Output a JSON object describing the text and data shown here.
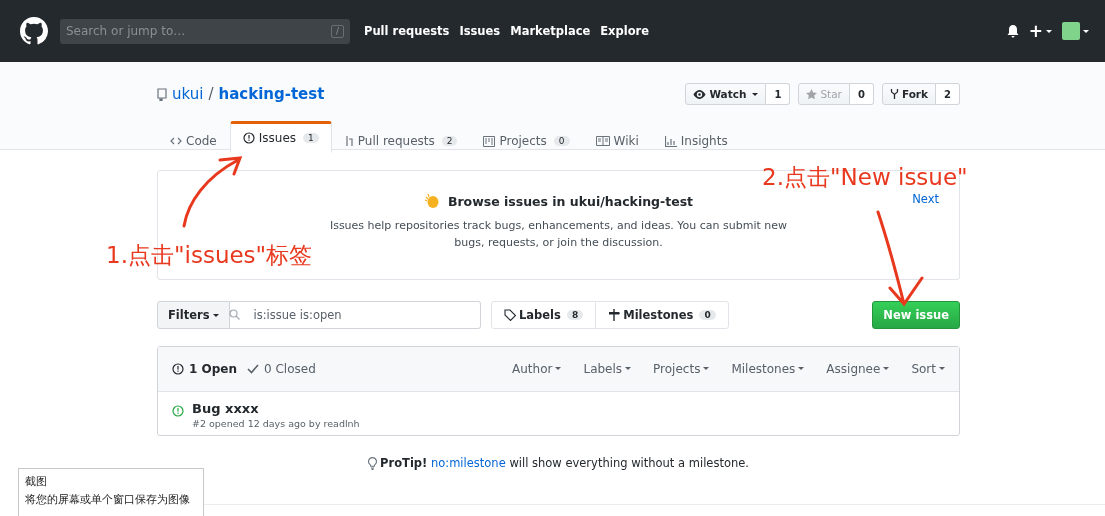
{
  "header": {
    "search": {
      "placeholder": "Search or jump to…",
      "key": "/"
    },
    "nav": [
      "Pull requests",
      "Issues",
      "Marketplace",
      "Explore"
    ],
    "plus": "+"
  },
  "repo": {
    "owner": "ukui",
    "separator": "/",
    "name": "hacking-test",
    "actions": [
      {
        "kind": "watch",
        "label": "Watch",
        "count": "1",
        "disabled": false
      },
      {
        "kind": "star",
        "label": "Star",
        "count": "0",
        "disabled": true
      },
      {
        "kind": "fork",
        "label": "Fork",
        "count": "2",
        "disabled": false
      }
    ],
    "tabs": [
      {
        "kind": "code",
        "label": "Code",
        "selected": false
      },
      {
        "kind": "issues",
        "label": "Issues",
        "counter": "1",
        "selected": true
      },
      {
        "kind": "pulls",
        "label": "Pull requests",
        "counter": "2",
        "selected": false
      },
      {
        "kind": "projects",
        "label": "Projects",
        "counter": "0",
        "selected": false
      },
      {
        "kind": "wiki",
        "label": "Wiki",
        "selected": false
      },
      {
        "kind": "insights",
        "label": "Insights",
        "selected": false
      }
    ]
  },
  "welcome": {
    "title": "Browse issues in ukui/hacking-test",
    "body": "Issues help repositories track bugs, enhancements, and ideas. You can submit new bugs, requests, or join the discussion.",
    "next": "Next"
  },
  "toolbar": {
    "filters": "Filters",
    "search_value": "is:issue is:open",
    "labels": {
      "label": "Labels",
      "count": "8"
    },
    "milestones": {
      "label": "Milestones",
      "count": "0"
    },
    "new_issue": "New issue"
  },
  "issues": {
    "states": [
      {
        "kind": "open",
        "label": "1 Open",
        "selected": true
      },
      {
        "kind": "closed",
        "label": "0 Closed",
        "selected": false
      }
    ],
    "filters": [
      "Author",
      "Labels",
      "Projects",
      "Milestones",
      "Assignee",
      "Sort"
    ],
    "rows": [
      {
        "title": "Bug xxxx",
        "meta": "#2 opened 12 days ago by readlnh"
      }
    ]
  },
  "protip": {
    "lead": "ProTip!",
    "link": "no:milestone",
    "rest": "will show everything without a milestone."
  },
  "tooltip": {
    "title": "截图",
    "description": "将您的屏幕或单个窗口保存为图像"
  },
  "annotations": [
    {
      "text": "1.点击\"issues\"标签"
    },
    {
      "text": "2.点击\"New issue\""
    }
  ]
}
